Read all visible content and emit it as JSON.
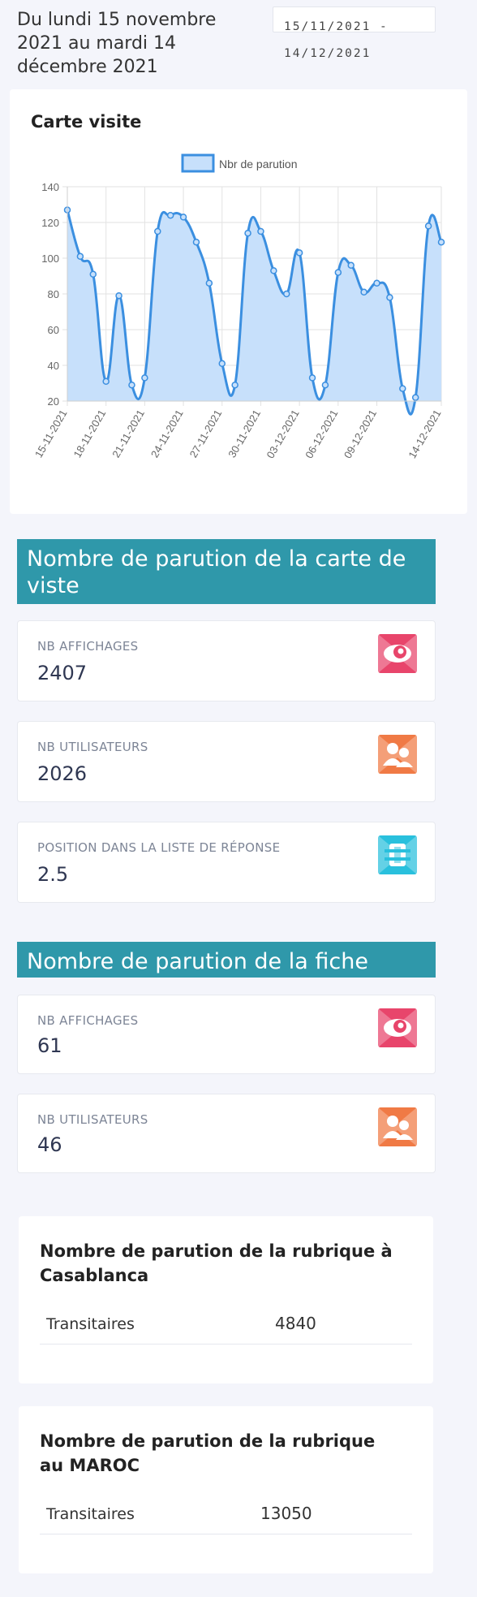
{
  "header": {
    "period_line1": "Du lundi 15 novembre",
    "period_line2": "2021 au mardi 14",
    "period_line3": "décembre 2021",
    "date_start": "15/11/2021 -",
    "date_end": "14/12/2021"
  },
  "chart_card": {
    "title": "Carte visite"
  },
  "chart_data": {
    "type": "area",
    "title": "",
    "legend": [
      "Nbr de parution"
    ],
    "legend_position": "top",
    "grid": true,
    "ylim": [
      20,
      140
    ],
    "yticks": [
      20,
      40,
      60,
      80,
      100,
      120,
      140
    ],
    "x_tick_labels": [
      "15-11-2021",
      "18-11-2021",
      "21-11-2021",
      "24-11-2021",
      "27-11-2021",
      "30-11-2021",
      "03-12-2021",
      "06-12-2021",
      "09-12-2021",
      "14-12-2021"
    ],
    "series": [
      {
        "name": "Nbr de parution",
        "color": "#3b8fe0",
        "fill": "#c7e0fb",
        "x": [
          "15-11-2021",
          "16-11-2021",
          "17-11-2021",
          "18-11-2021",
          "19-11-2021",
          "20-11-2021",
          "21-11-2021",
          "22-11-2021",
          "23-11-2021",
          "24-11-2021",
          "25-11-2021",
          "26-11-2021",
          "27-11-2021",
          "28-11-2021",
          "29-11-2021",
          "30-11-2021",
          "01-12-2021",
          "02-12-2021",
          "03-12-2021",
          "04-12-2021",
          "05-12-2021",
          "06-12-2021",
          "07-12-2021",
          "08-12-2021",
          "09-12-2021",
          "10-12-2021",
          "11-12-2021",
          "12-12-2021",
          "13-12-2021",
          "14-12-2021"
        ],
        "values": [
          127,
          101,
          91,
          31,
          79,
          29,
          33,
          115,
          124,
          123,
          109,
          86,
          41,
          29,
          114,
          115,
          93,
          80,
          103,
          33,
          29,
          92,
          96,
          81,
          86,
          78,
          27,
          22,
          118,
          109
        ]
      }
    ]
  },
  "section_carte": {
    "title_line1": "Nombre de parution de la carte de",
    "title_line2": "viste",
    "stats": [
      {
        "label": "NB AFFICHAGES",
        "value": "2407",
        "icon": "eye-icon",
        "color": "#e8456b"
      },
      {
        "label": "NB UTILISATEURS",
        "value": "2026",
        "icon": "users-icon",
        "color": "#f07a45"
      },
      {
        "label": "POSITION DANS LA LISTE DE RÉPONSE",
        "value": "2.5",
        "icon": "list-icon",
        "color": "#29c0dd"
      }
    ]
  },
  "section_fiche": {
    "title": "Nombre de parution de la fiche",
    "stats": [
      {
        "label": "NB AFFICHAGES",
        "value": "61",
        "icon": "eye-icon",
        "color": "#e8456b"
      },
      {
        "label": "NB UTILISATEURS",
        "value": "46",
        "icon": "users-icon",
        "color": "#f07a45"
      }
    ]
  },
  "rubrique_casablanca": {
    "title": "Nombre de parution de la rubrique à Casablanca",
    "row_name": "Transitaires",
    "row_value": "4840"
  },
  "rubrique_maroc": {
    "title": "Nombre de parution de la rubrique au MAROC",
    "row_name": "Transitaires",
    "row_value": "13050"
  }
}
